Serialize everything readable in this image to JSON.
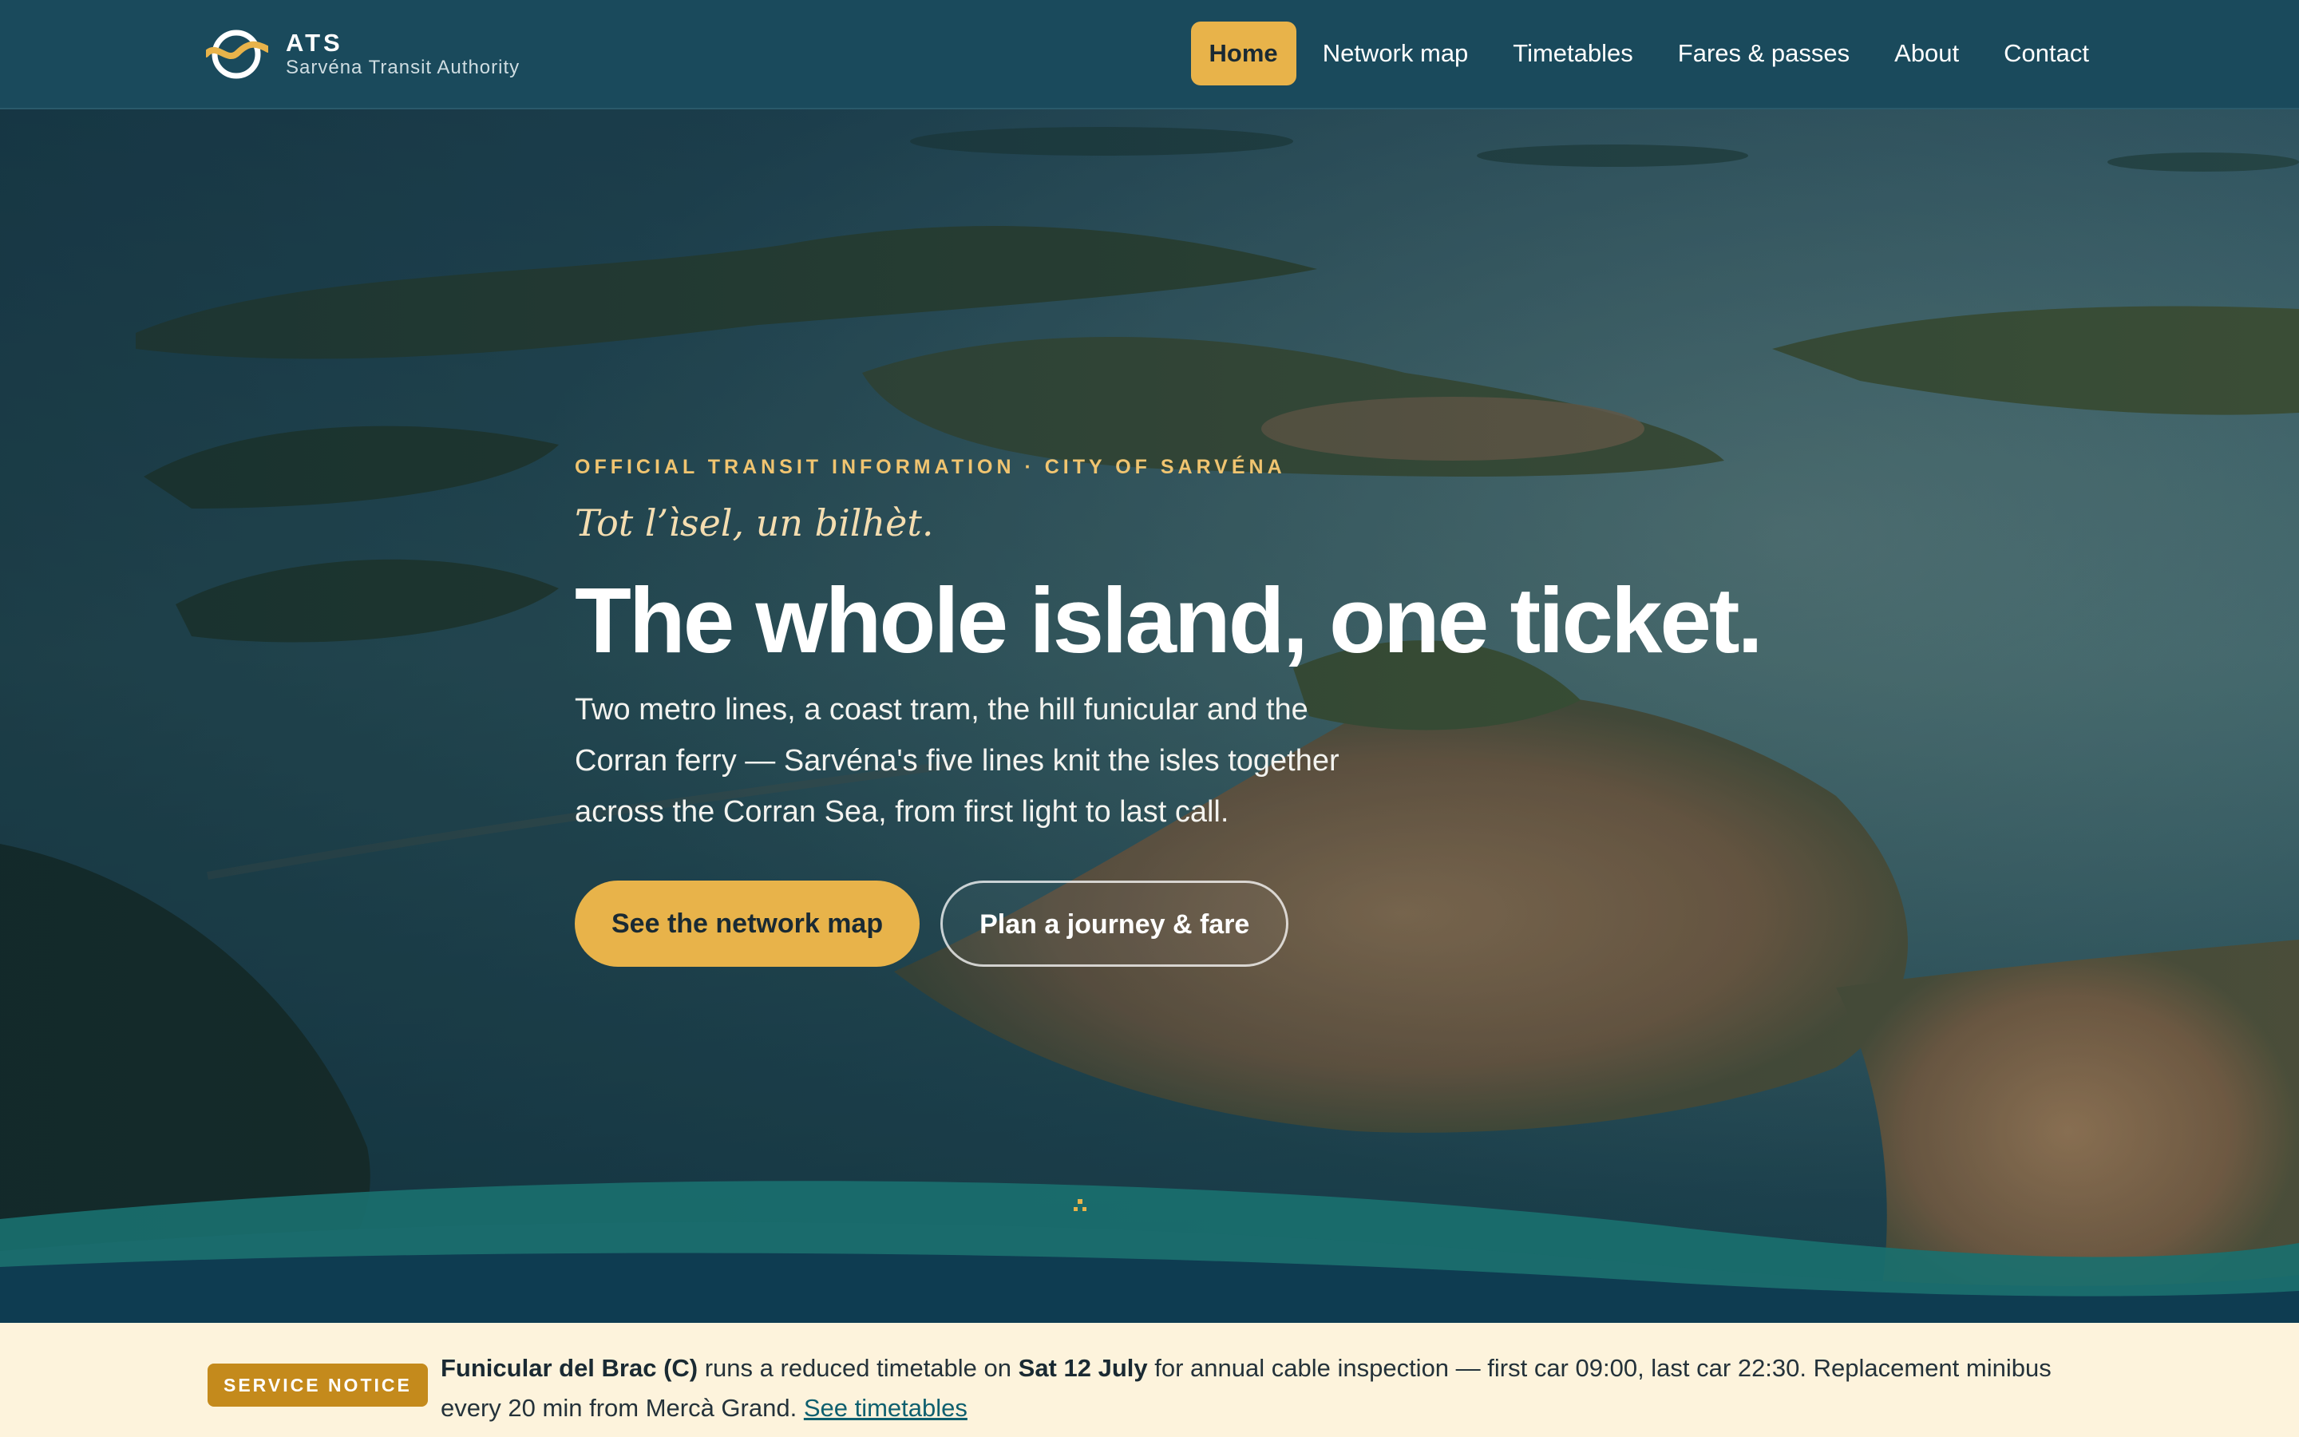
{
  "header": {
    "brand_name": "ATS",
    "brand_subtitle": "Sarvéna Transit Authority",
    "logo_icon": "ats-logo-icon"
  },
  "nav": {
    "items": [
      {
        "label": "Home",
        "active": true
      },
      {
        "label": "Network map",
        "active": false
      },
      {
        "label": "Timetables",
        "active": false
      },
      {
        "label": "Fares & passes",
        "active": false
      },
      {
        "label": "About",
        "active": false
      },
      {
        "label": "Contact",
        "active": false
      }
    ]
  },
  "hero": {
    "eyebrow": "OFFICIAL TRANSIT INFORMATION · CITY OF SARVÉNA",
    "tagline": "Tot l’ìsel, un bilhèt.",
    "headline": "The whole island, one ticket.",
    "lede": "Two metro lines, a coast tram, the hill funicular and the Corran ferry — Sarvéna's five lines knit the isles together across the Corran Sea, from first light to last call.",
    "primary_cta": "See the network map",
    "secondary_cta": "Plan a journey & fare"
  },
  "notice": {
    "badge": "SERVICE NOTICE",
    "line_name": "Funicular del Brac (C)",
    "text_1": " runs a reduced timetable on ",
    "date": "Sat 12 July",
    "text_2": " for annual cable inspection — first car 09:00, last car 22:30. Replacement minibus every 20 min from Mercà Grand. ",
    "link_label": "See timetables"
  },
  "colors": {
    "header_bg": "#1a4a5c",
    "accent": "#e8b34a",
    "notice_bg": "#fdf3dc",
    "badge_bg": "#c48a1c",
    "link": "#0f5f6e"
  }
}
